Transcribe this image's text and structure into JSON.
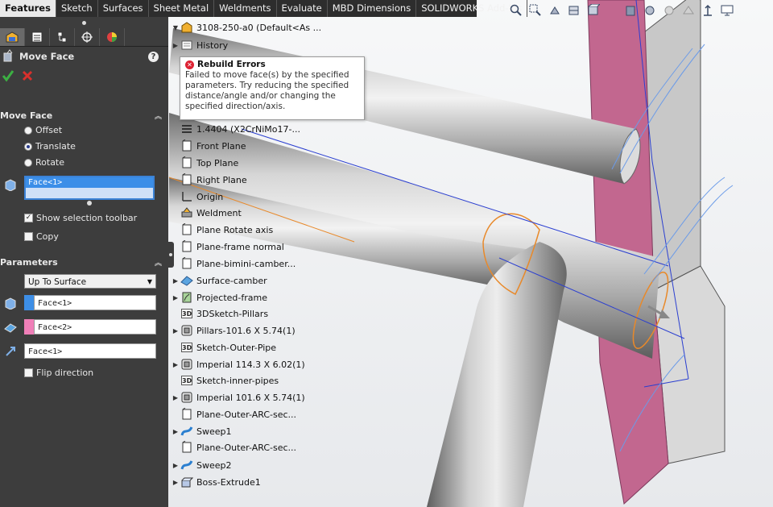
{
  "tabs": [
    {
      "label": "Features",
      "active": true
    },
    {
      "label": "Sketch"
    },
    {
      "label": "Surfaces"
    },
    {
      "label": "Sheet Metal"
    },
    {
      "label": "Weldments"
    },
    {
      "label": "Evaluate"
    },
    {
      "label": "MBD Dimensions"
    },
    {
      "label": "SOLIDWORKS Add-Ins"
    }
  ],
  "property_manager": {
    "title": "Move Face",
    "help_glyph": "?",
    "move_face_section": {
      "heading": "Move Face",
      "options": [
        "Offset",
        "Translate",
        "Rotate"
      ],
      "selected_option": "Translate",
      "selection_item": "Face<1>",
      "show_selection_toolbar_label": "Show selection toolbar",
      "show_selection_toolbar_checked": true,
      "copy_label": "Copy",
      "copy_checked": false
    },
    "parameters_section": {
      "heading": "Parameters",
      "end_condition": "Up To Surface",
      "face_1": "Face<1>",
      "face_2": "Face<2>",
      "direction_ref": "Face<1>",
      "flip_direction_label": "Flip direction",
      "flip_direction_checked": false,
      "face_1_color": "#3d8ee6",
      "face_2_color": "#f07fb8"
    }
  },
  "tooltip": {
    "title": "Rebuild Errors",
    "lines": [
      "Failed to move face(s) by the specified",
      "parameters. Try reducing the specified",
      "distance/angle and/or changing the",
      "specified direction/axis."
    ]
  },
  "tree": {
    "root": "3108-250-a0  (Default<As ...",
    "items": [
      {
        "label": "History",
        "icon": "history-icon",
        "expand": true
      },
      {
        "label": "1.4404 (X2CrNiMo17-...",
        "icon": "material-icon",
        "expand": false
      },
      {
        "label": "Front Plane",
        "icon": "plane-icon",
        "expand": false
      },
      {
        "label": "Top Plane",
        "icon": "plane-icon",
        "expand": false
      },
      {
        "label": "Right Plane",
        "icon": "plane-icon",
        "expand": false
      },
      {
        "label": "Origin",
        "icon": "origin-icon",
        "expand": false
      },
      {
        "label": "Weldment",
        "icon": "weldment-icon",
        "expand": false
      },
      {
        "label": "Plane Rotate axis",
        "icon": "plane-icon",
        "expand": false
      },
      {
        "label": "Plane-frame normal",
        "icon": "plane-icon",
        "expand": false
      },
      {
        "label": "Plane-bimini-camber...",
        "icon": "plane-icon",
        "expand": false
      },
      {
        "label": "Surface-camber",
        "icon": "surface-icon",
        "expand": true
      },
      {
        "label": "Projected-frame",
        "icon": "projected-curve-icon",
        "expand": true
      },
      {
        "label": "3DSketch-Pillars",
        "icon": "3dsketch-icon",
        "expand": false
      },
      {
        "label": "Pillars-101.6 X 5.74(1)",
        "icon": "structural-member-icon",
        "expand": true
      },
      {
        "label": "Sketch-Outer-Pipe",
        "icon": "3dsketch-icon",
        "expand": false
      },
      {
        "label": "Imperial 114.3 X 6.02(1)",
        "icon": "structural-member-icon",
        "expand": true
      },
      {
        "label": "Sketch-inner-pipes",
        "icon": "3dsketch-icon",
        "expand": false
      },
      {
        "label": "Imperial 101.6 X 5.74(1)",
        "icon": "structural-member-icon",
        "expand": true
      },
      {
        "label": "Plane-Outer-ARC-sec...",
        "icon": "plane-icon",
        "expand": false
      },
      {
        "label": "Sweep1",
        "icon": "sweep-icon",
        "expand": true
      },
      {
        "label": "Plane-Outer-ARC-sec...",
        "icon": "plane-icon",
        "expand": false
      },
      {
        "label": "Sweep2",
        "icon": "sweep-icon",
        "expand": true
      },
      {
        "label": "Boss-Extrude1",
        "icon": "extrude-icon",
        "expand": true
      }
    ]
  },
  "colors": {
    "pm_background": "#3d3d3d",
    "tab_bar": "#2d2d2d",
    "pipe_gray": "#9a9a9a",
    "plate_pink": "#c2678f",
    "sketch_blue": "#2b3fd0",
    "selection_orange": "#e8892a"
  }
}
